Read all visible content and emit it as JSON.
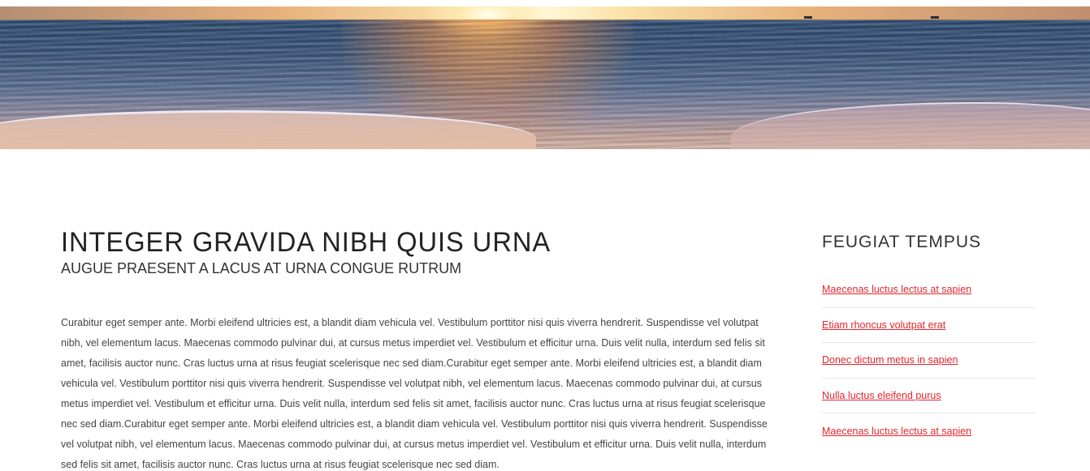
{
  "hero": {
    "alt": "Sunset over ocean waves on a beach"
  },
  "main": {
    "title": "INTEGER GRAVIDA NIBH QUIS URNA",
    "subtitle": "AUGUE PRAESENT A LACUS AT URNA CONGUE RUTRUM",
    "body": "Curabitur eget semper ante. Morbi eleifend ultricies est, a blandit diam vehicula vel. Vestibulum porttitor nisi quis viverra hendrerit. Suspendisse vel volutpat nibh, vel elementum lacus. Maecenas commodo pulvinar dui, at cursus metus imperdiet vel. Vestibulum et efficitur urna. Duis velit nulla, interdum sed felis sit amet, facilisis auctor nunc. Cras luctus urna at risus feugiat scelerisque nec sed diam.Curabitur eget semper ante. Morbi eleifend ultricies est, a blandit diam vehicula vel. Vestibulum porttitor nisi quis viverra hendrerit. Suspendisse vel volutpat nibh, vel elementum lacus. Maecenas commodo pulvinar dui, at cursus metus imperdiet vel. Vestibulum et efficitur urna. Duis velit nulla, interdum sed felis sit amet, facilisis auctor nunc. Cras luctus urna at risus feugiat scelerisque nec sed diam.Curabitur eget semper ante. Morbi eleifend ultricies est, a blandit diam vehicula vel. Vestibulum porttitor nisi quis viverra hendrerit. Suspendisse vel volutpat nibh, vel elementum lacus. Maecenas commodo pulvinar dui, at cursus metus imperdiet vel. Vestibulum et efficitur urna. Duis velit nulla, interdum sed felis sit amet, facilisis auctor nunc. Cras luctus urna at risus feugiat scelerisque nec sed diam."
  },
  "sidebar": {
    "title": "FEUGIAT TEMPUS",
    "links": [
      {
        "label": "Maecenas luctus lectus at sapien"
      },
      {
        "label": "Etiam rhoncus volutpat erat"
      },
      {
        "label": "Donec dictum metus in sapien"
      },
      {
        "label": "Nulla luctus eleifend purus"
      },
      {
        "label": "Maecenas luctus lectus at sapien"
      }
    ]
  },
  "colors": {
    "link": "#e3262d",
    "heading": "#222222",
    "body_text": "#444444",
    "divider": "#e6e6e6"
  }
}
